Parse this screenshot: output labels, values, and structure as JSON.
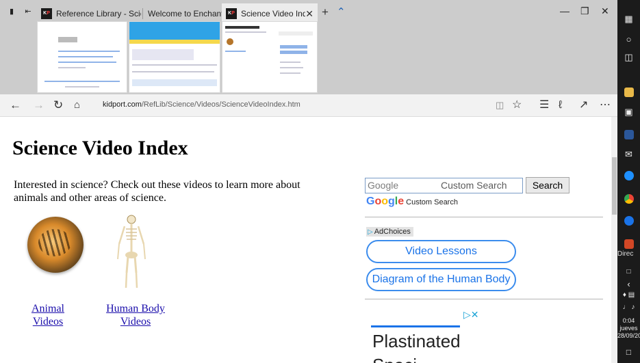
{
  "tabs": [
    {
      "title": "Reference Library - Science",
      "favicon": "KP",
      "active": false
    },
    {
      "title": "Welcome to Enchanted Lear",
      "favicon": "",
      "active": false
    },
    {
      "title": "Science Video Index",
      "favicon": "KP",
      "active": true
    }
  ],
  "address": {
    "host": "kidport.com",
    "path": "/RefLib/Science/Videos/ScienceVideoIndex.htm"
  },
  "page": {
    "heading": "Science Video Index",
    "intro": "Interested in science? Check out these videos to learn more about animals and other areas of science.",
    "videos": [
      {
        "line1": "Animal",
        "line2": "Videos"
      },
      {
        "line1": "Human Body",
        "line2": "Videos"
      }
    ]
  },
  "search": {
    "placeholder_left": "Google",
    "placeholder_right": "Custom Search",
    "button": "Search",
    "branding": "Custom Search"
  },
  "ads": {
    "adchoices": "AdChoices",
    "links": [
      "Video Lessons",
      "Diagram of the Human Body"
    ],
    "banner_title": "Plastinated",
    "banner_cut": "Speci"
  },
  "taskbar": {
    "label": "Direc",
    "time": "0:04",
    "day": "jueves",
    "date": "28/09/20"
  },
  "colors": {
    "accent": "#1a73e8",
    "link": "#1a0dab",
    "tabbar": "#cccccc"
  }
}
